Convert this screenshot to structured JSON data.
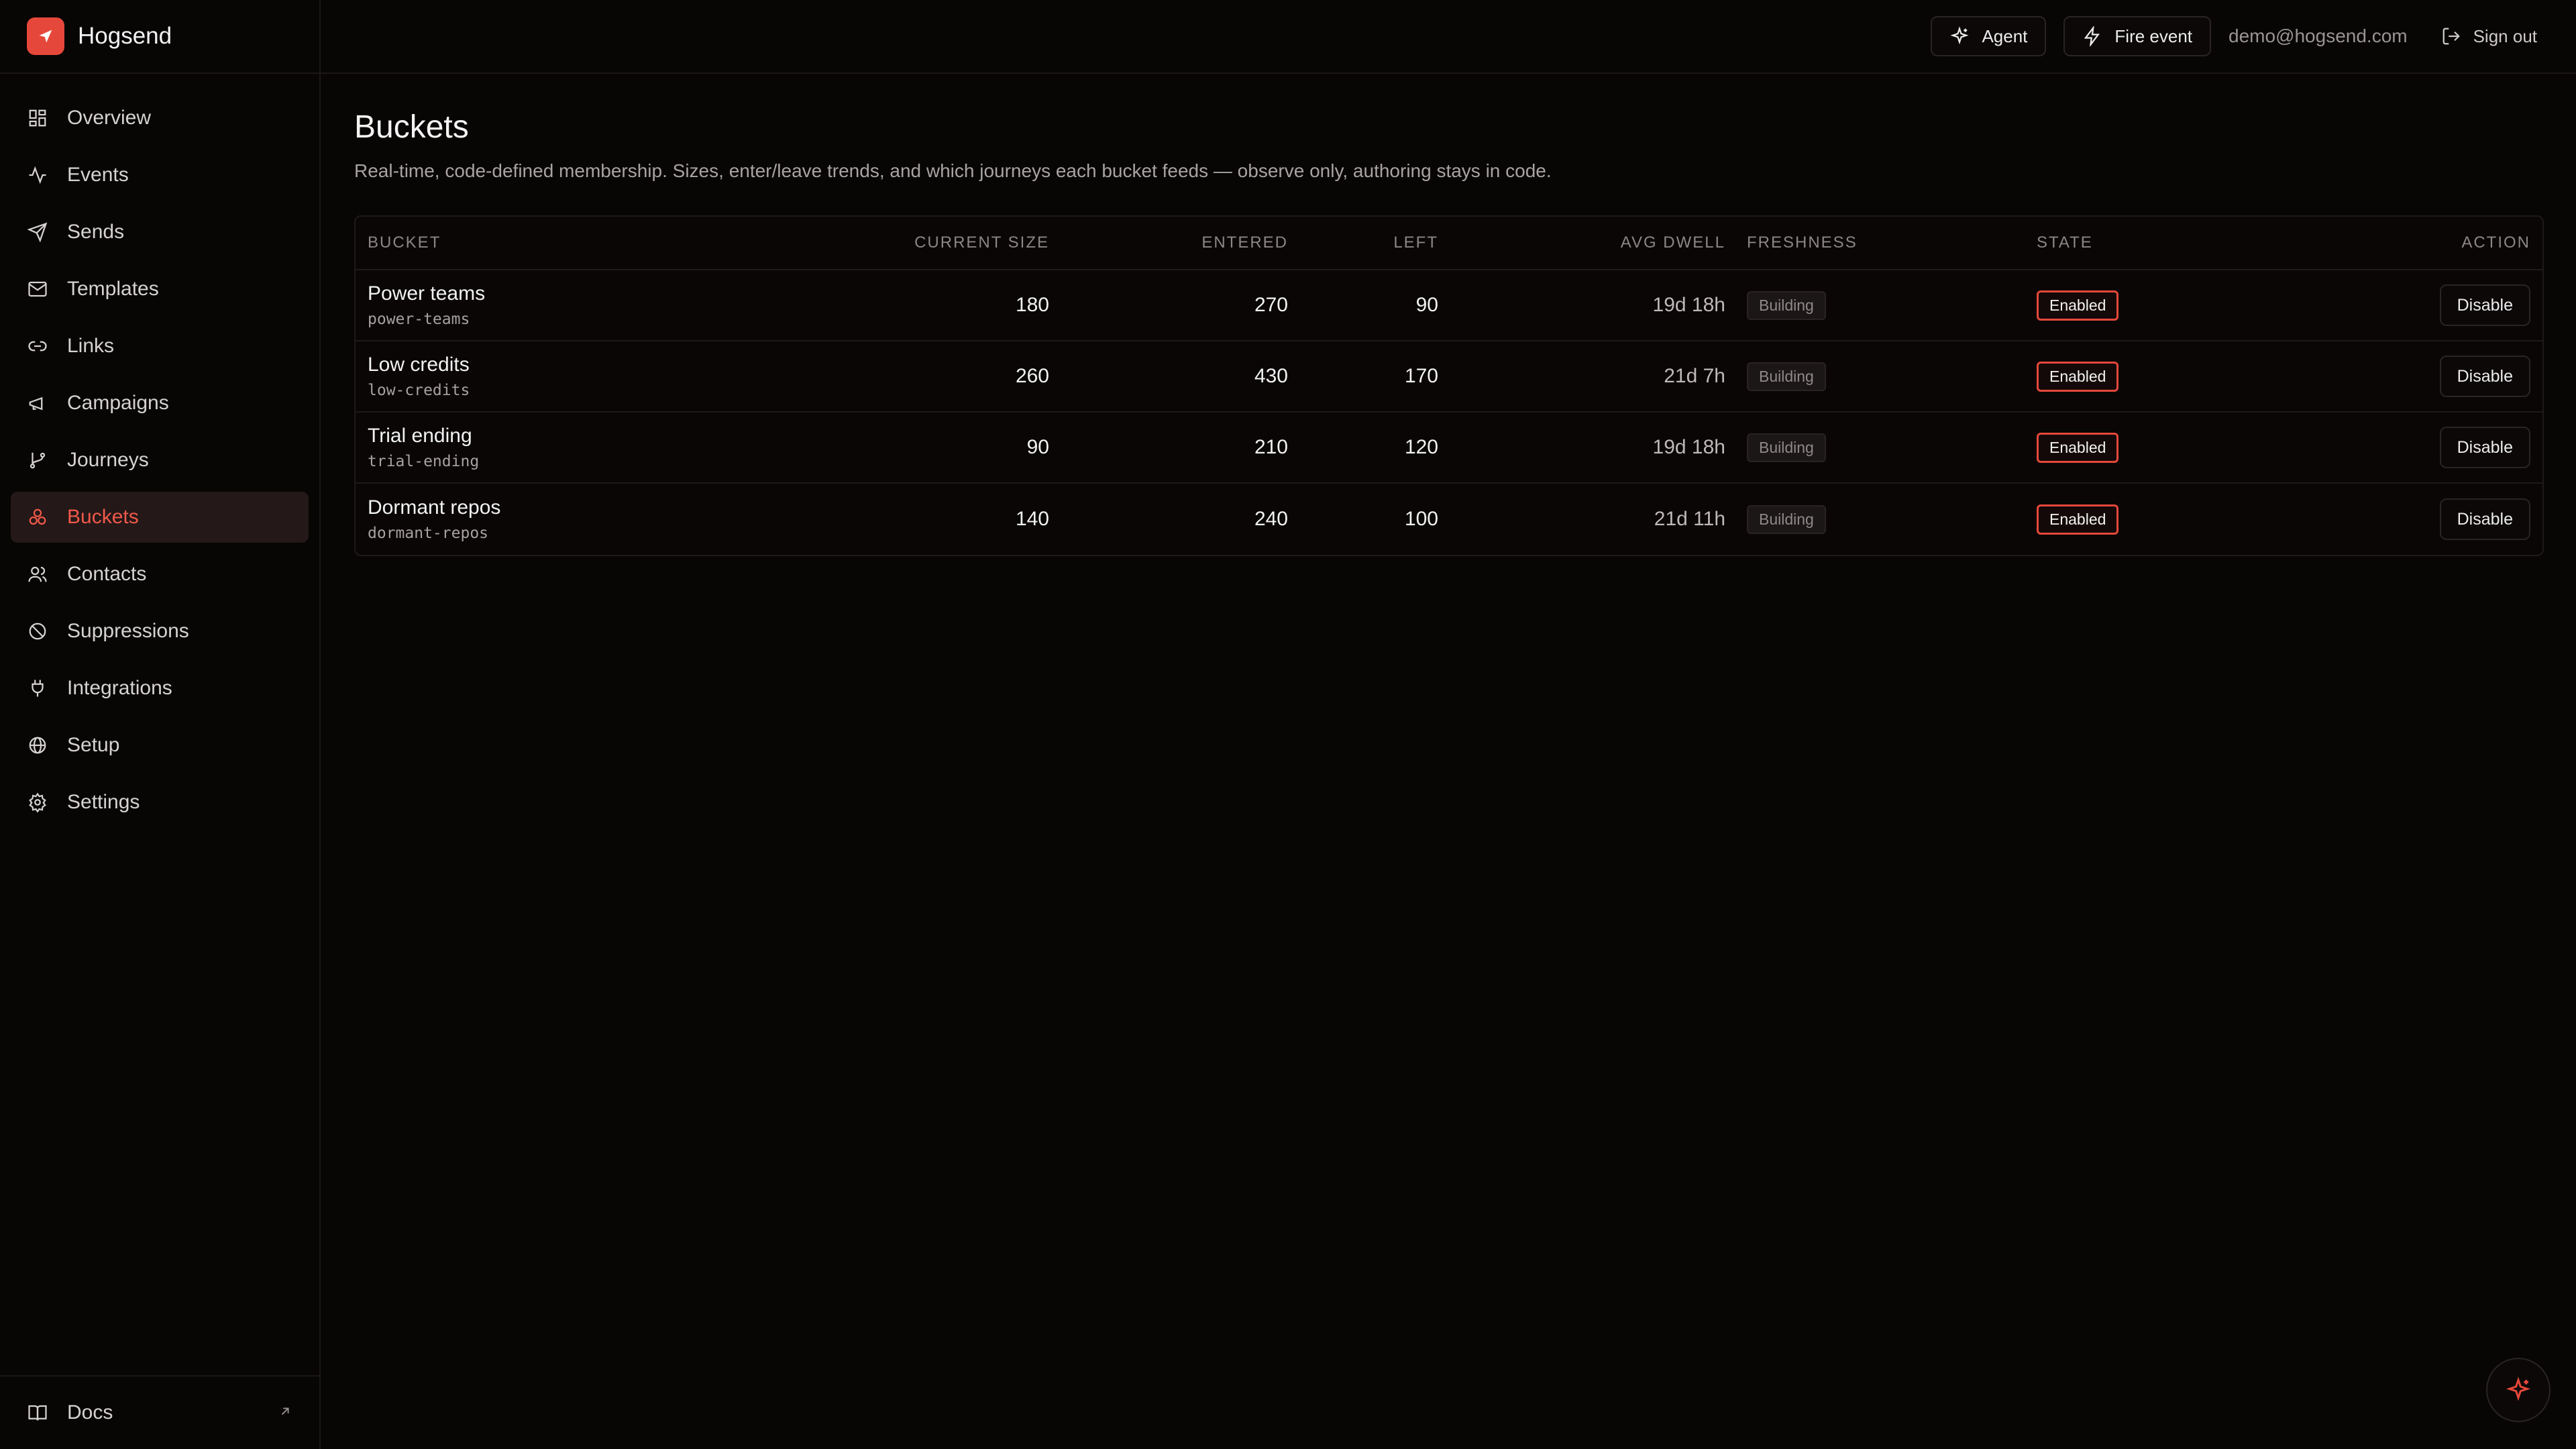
{
  "app": {
    "name": "Hogsend",
    "logo_icon": "send-icon",
    "brand_color": "#e5483a"
  },
  "sidebar": {
    "items": [
      {
        "label": "Overview",
        "icon": "grid-icon"
      },
      {
        "label": "Events",
        "icon": "activity-icon"
      },
      {
        "label": "Sends",
        "icon": "send-icon"
      },
      {
        "label": "Templates",
        "icon": "mail-icon"
      },
      {
        "label": "Links",
        "icon": "link-icon"
      },
      {
        "label": "Campaigns",
        "icon": "megaphone-icon"
      },
      {
        "label": "Journeys",
        "icon": "git-branch-icon"
      },
      {
        "label": "Buckets",
        "icon": "buckets-icon",
        "active": true
      },
      {
        "label": "Contacts",
        "icon": "users-icon"
      },
      {
        "label": "Suppressions",
        "icon": "ban-icon"
      },
      {
        "label": "Integrations",
        "icon": "plug-icon"
      },
      {
        "label": "Setup",
        "icon": "globe-icon"
      },
      {
        "label": "Settings",
        "icon": "gear-icon"
      }
    ],
    "footer": {
      "label": "Docs",
      "icon": "book-icon",
      "external_icon": "arrow-up-right-icon"
    }
  },
  "topbar": {
    "agent_label": "Agent",
    "fire_event_label": "Fire event",
    "user_email": "demo@hogsend.com",
    "sign_out_label": "Sign out"
  },
  "page": {
    "title": "Buckets",
    "description": "Real-time, code-defined membership. Sizes, enter/leave trends, and which journeys each bucket feeds — observe only, authoring stays in code."
  },
  "table": {
    "columns": {
      "bucket": "BUCKET",
      "current_size": "CURRENT SIZE",
      "entered": "ENTERED",
      "left": "LEFT",
      "avg_dwell": "AVG DWELL",
      "freshness": "FRESHNESS",
      "state": "STATE",
      "action": "ACTION"
    },
    "rows": [
      {
        "name": "Power teams",
        "slug": "power-teams",
        "current_size": "180",
        "entered": "270",
        "left": "90",
        "avg_dwell": "19d 18h",
        "freshness": "Building",
        "state": "Enabled",
        "action": "Disable"
      },
      {
        "name": "Low credits",
        "slug": "low-credits",
        "current_size": "260",
        "entered": "430",
        "left": "170",
        "avg_dwell": "21d 7h",
        "freshness": "Building",
        "state": "Enabled",
        "action": "Disable"
      },
      {
        "name": "Trial ending",
        "slug": "trial-ending",
        "current_size": "90",
        "entered": "210",
        "left": "120",
        "avg_dwell": "19d 18h",
        "freshness": "Building",
        "state": "Enabled",
        "action": "Disable"
      },
      {
        "name": "Dormant repos",
        "slug": "dormant-repos",
        "current_size": "140",
        "entered": "240",
        "left": "100",
        "avg_dwell": "21d 11h",
        "freshness": "Building",
        "state": "Enabled",
        "action": "Disable"
      }
    ]
  },
  "fab": {
    "icon": "sparkle-icon"
  }
}
